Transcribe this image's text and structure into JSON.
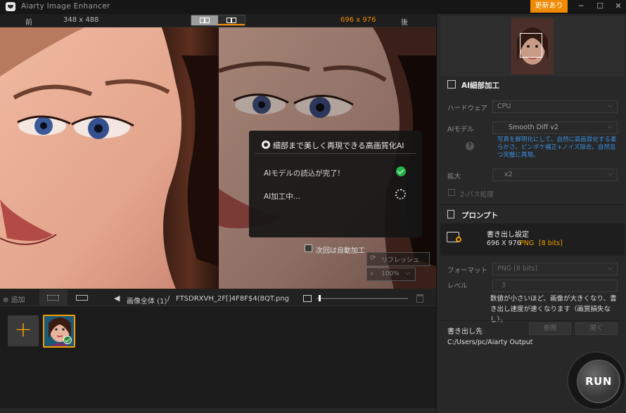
{
  "app": {
    "title": "Aiarty Image Enhancer",
    "update_label": "更新あり"
  },
  "compare": {
    "before_label": "前",
    "before_size": "348 x 488",
    "after_size": "696 x 976",
    "after_label": "後"
  },
  "dialog": {
    "title": "細部まで美しく再現できる高画質化AI",
    "row1": "AIモデルの読込が完了!",
    "row2": "AI加工中..."
  },
  "canvas": {
    "auto_label": "次回は自動加工",
    "refresh_label": "リフレッシュ",
    "zoom": "100%"
  },
  "thumbbar": {
    "add_label": "追加",
    "path_all": "画像全体 (1)",
    "path_sep": "/",
    "path_file": "FTSDRXVH_2F[]4F8F$4(8QT.png",
    "thumb_size": 0.02
  },
  "panel": {
    "ai_section": "AI細部加工",
    "hardware_label": "ハードウェア",
    "hardware_value": "CPU",
    "model_label": "AIモデル",
    "model_value": "Smooth Diff v2",
    "model_desc": "写真を鮮明化にして、自然に高画質化する柔らかさ。ピンボケ補正+ノイズ除去。自然且つ完璧に再現。",
    "scale_label": "拡大",
    "scale_value": "x2",
    "twopass_label": "2-パス処理",
    "prompt_section": "プロンプト",
    "export_title": "書き出し設定",
    "export_dims": "696 X 976",
    "export_format": "PNG",
    "export_bits": "[8 bits]",
    "format_label": "フォーマット",
    "format_value": "PNG   [8 bits]",
    "level_label": "レベル",
    "level_value": "3",
    "level_desc": "数値が小さいほど、画像が大きくなり、書き出し速度が速くなります（画質損失なし）。",
    "output_label": "書き出し先",
    "output_path": "C:/Users/pc/Aiarty Output",
    "browse_label": "参照",
    "open_label": "開く",
    "run_label": "RUN"
  },
  "colors": {
    "accent": "#f08a00",
    "link": "#3a8fe0",
    "success": "#26b34a"
  },
  "icons": [
    "logo-icon",
    "chevron-down-icon",
    "minimize-icon",
    "maximize-icon",
    "close-icon",
    "split-view-icon",
    "side-by-side-icon",
    "shutter-icon",
    "check-icon",
    "spinner-icon",
    "refresh-icon",
    "zoom-icon",
    "plus-icon",
    "grid-icon",
    "list-icon",
    "back-arrow-icon",
    "image-icon",
    "trash-icon",
    "help-icon",
    "ai-enhance-icon",
    "prompt-icon",
    "export-settings-icon"
  ]
}
